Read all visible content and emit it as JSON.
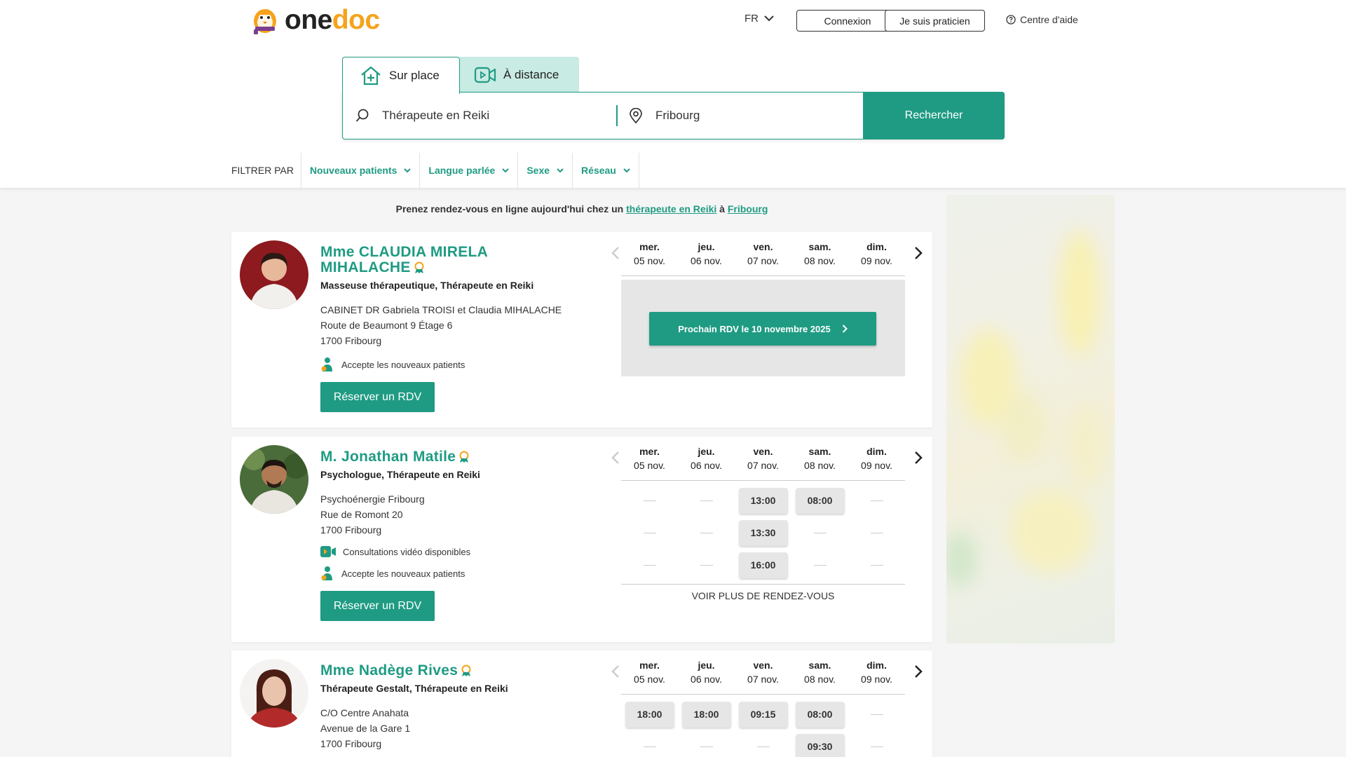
{
  "header": {
    "logo_part1": "one",
    "logo_part2": "doc",
    "lang": "FR",
    "login": "Connexion",
    "practitioner": "Je suis praticien",
    "help": "Centre d'aide"
  },
  "search": {
    "tab_onsite": "Sur place",
    "tab_remote": "À distance",
    "what_value": "Thérapeute en Reiki",
    "where_value": "Fribourg",
    "submit": "Rechercher"
  },
  "filters": {
    "label": "FILTRER PAR",
    "items": [
      "Nouveaux patients",
      "Langue parlée",
      "Sexe",
      "Réseau"
    ]
  },
  "intro": {
    "prefix": "Prenez rendez-vous en ligne aujourd'hui chez un",
    "link1": "thérapeute en Reiki",
    "mid": "à",
    "link2": "Fribourg"
  },
  "days": [
    {
      "name": "mer.",
      "date": "05 nov."
    },
    {
      "name": "jeu.",
      "date": "06 nov."
    },
    {
      "name": "ven.",
      "date": "07 nov."
    },
    {
      "name": "sam.",
      "date": "08 nov."
    },
    {
      "name": "dim.",
      "date": "09 nov."
    }
  ],
  "practitioners": [
    {
      "name_line1": "Mme CLAUDIA MIRELA",
      "name_line2": "MIHALACHE",
      "specialty": "Masseuse thérapeutique, Thérapeute en Reiki",
      "address": [
        "CABINET DR Gabriela TROISI et Claudia MIHALACHE",
        "Route de Beaumont 9 Étage 6",
        "1700 Fribourg"
      ],
      "new_patients": "Accepte les nouveaux patients",
      "book": "Réserver un RDV",
      "next_appt": "Prochain RDV le 10 novembre 2025"
    },
    {
      "name": "M. Jonathan Matile",
      "specialty": "Psychologue, Thérapeute en Reiki",
      "address": [
        "Psychoénergie Fribourg",
        "Rue de Romont 20",
        "1700 Fribourg"
      ],
      "video": "Consultations vidéo disponibles",
      "new_patients": "Accepte les nouveaux patients",
      "book": "Réserver un RDV",
      "slots": [
        [
          "",
          "",
          "13:00",
          "08:00",
          ""
        ],
        [
          "",
          "",
          "13:30",
          "",
          ""
        ],
        [
          "",
          "",
          "16:00",
          "",
          ""
        ]
      ],
      "more": "VOIR PLUS DE RENDEZ-VOUS"
    },
    {
      "name": "Mme Nadège Rives",
      "specialty": "Thérapeute Gestalt, Thérapeute en Reiki",
      "address": [
        "C/O Centre Anahata",
        "Avenue de la Gare 1",
        "1700 Fribourg"
      ],
      "slots": [
        [
          "18:00",
          "18:00",
          "09:15",
          "08:00",
          ""
        ],
        [
          "",
          "",
          "",
          "09:30",
          ""
        ]
      ]
    }
  ],
  "colors": {
    "accent": "#1f9b83",
    "accent_light": "#c8ebe3",
    "logo_orange": "#f6a31b",
    "slot_bg": "#e6e6e6"
  }
}
